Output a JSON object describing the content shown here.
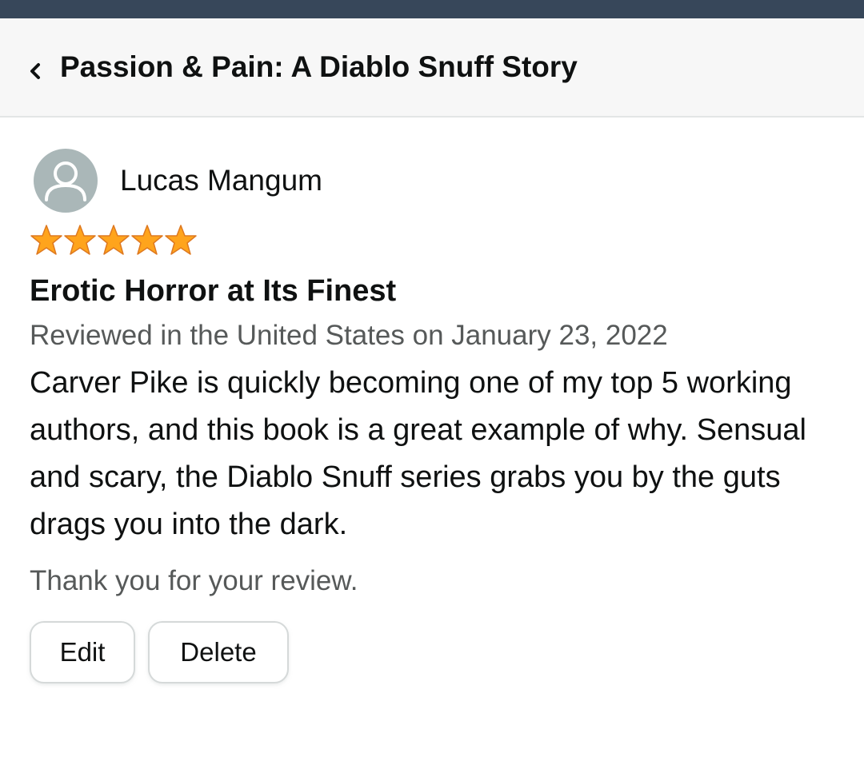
{
  "header": {
    "title": "Passion & Pain: A Diablo Snuff Story",
    "back_icon": "chevron-left-icon"
  },
  "review": {
    "reviewer_name": "Lucas Mangum",
    "avatar_icon": "user-icon",
    "rating": 5,
    "rating_max": 5,
    "title": "Erotic Horror at Its Finest",
    "meta": "Reviewed in the United States on January 23, 2022",
    "body": "Carver Pike is quickly becoming one of my top 5 working authors, and this book is a great example of why. Sensual and scary, the Diablo Snuff series grabs you by the guts drags you into the dark.",
    "thanks": "Thank you for your review."
  },
  "actions": {
    "edit_label": "Edit",
    "delete_label": "Delete"
  },
  "colors": {
    "top_bar": "#37475a",
    "header_bg": "#f7f7f7",
    "star": "#ffa41c",
    "star_outline": "#de7921",
    "avatar_bg": "#aab7b8",
    "meta_text": "#565959"
  }
}
